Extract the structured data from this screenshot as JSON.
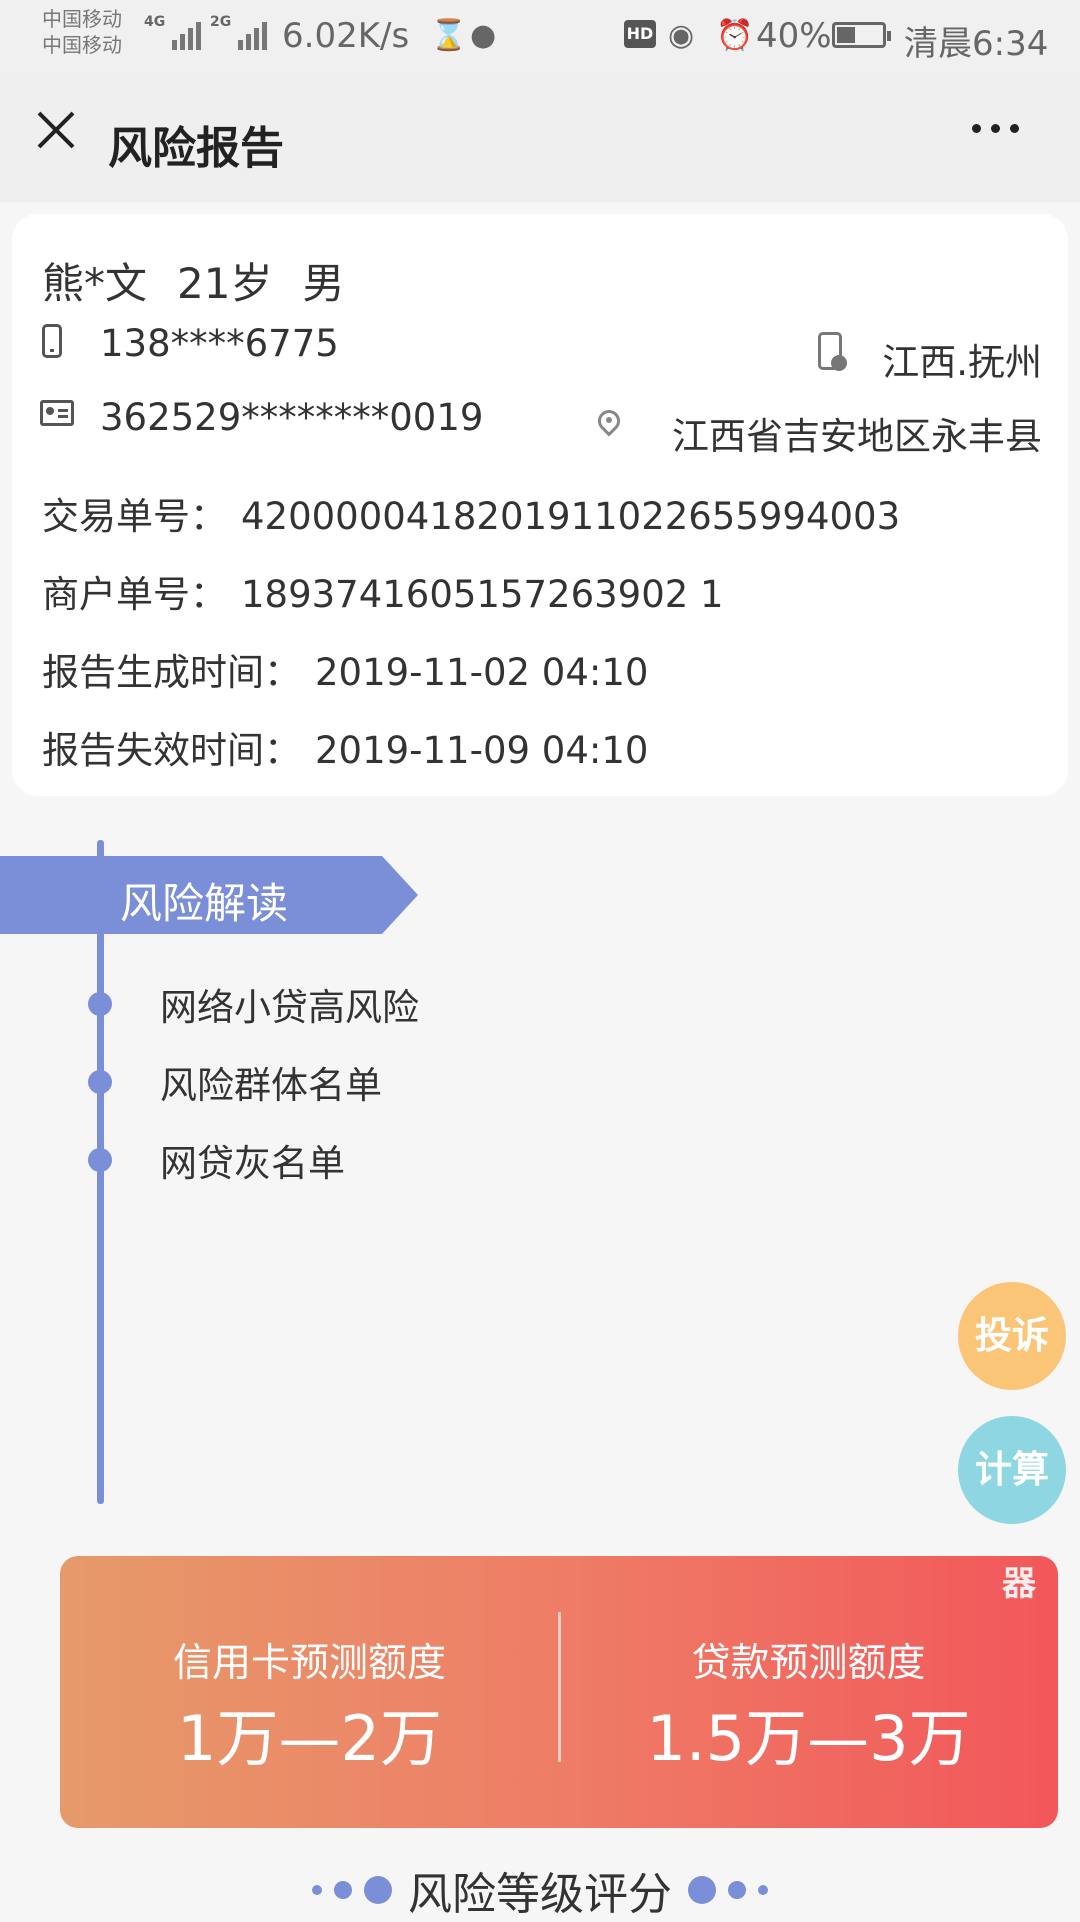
{
  "status_bar": {
    "carrier1": "中国移动",
    "carrier2": "中国移动",
    "sig1_tag": "4G",
    "sig2_tag": "2G",
    "net_speed": "6.02K/s",
    "hd": "HD",
    "battery": "40%",
    "battery_level": 0.4,
    "time": "清晨6:34"
  },
  "nav": {
    "title": "风险报告"
  },
  "profile": {
    "name": "熊*文",
    "age": "21岁",
    "gender": "男",
    "phone": "138****6775",
    "id_number": "362529********0019",
    "phone_location": "江西.抚州",
    "id_location": "江西省吉安地区永丰县",
    "fields": [
      {
        "label": "交易单号：",
        "value": "4200000418201911022655994003"
      },
      {
        "label": "商户单号：",
        "value": "1893741605157263902 1"
      },
      {
        "label": "报告生成时间：",
        "value": "2019-11-02 04:10"
      },
      {
        "label": "报告失效时间：",
        "value": "2019-11-09 04:10"
      }
    ]
  },
  "risk": {
    "heading": "风险解读",
    "items": [
      "网络小贷高风险",
      "风险群体名单",
      "网贷灰名单"
    ]
  },
  "fabs": {
    "complain": "投诉",
    "calc": "计算",
    "calc_suffix": "器"
  },
  "quota": {
    "credit_label": "信用卡预测额度",
    "credit_value": "1万—2万",
    "loan_label": "贷款预测额度",
    "loan_value": "1.5万—3万"
  },
  "section": {
    "title": "风险等级评分"
  },
  "colors": {
    "accent": "#7b8fd9",
    "complain": "#fbc578",
    "calc": "#8dd6e2"
  }
}
